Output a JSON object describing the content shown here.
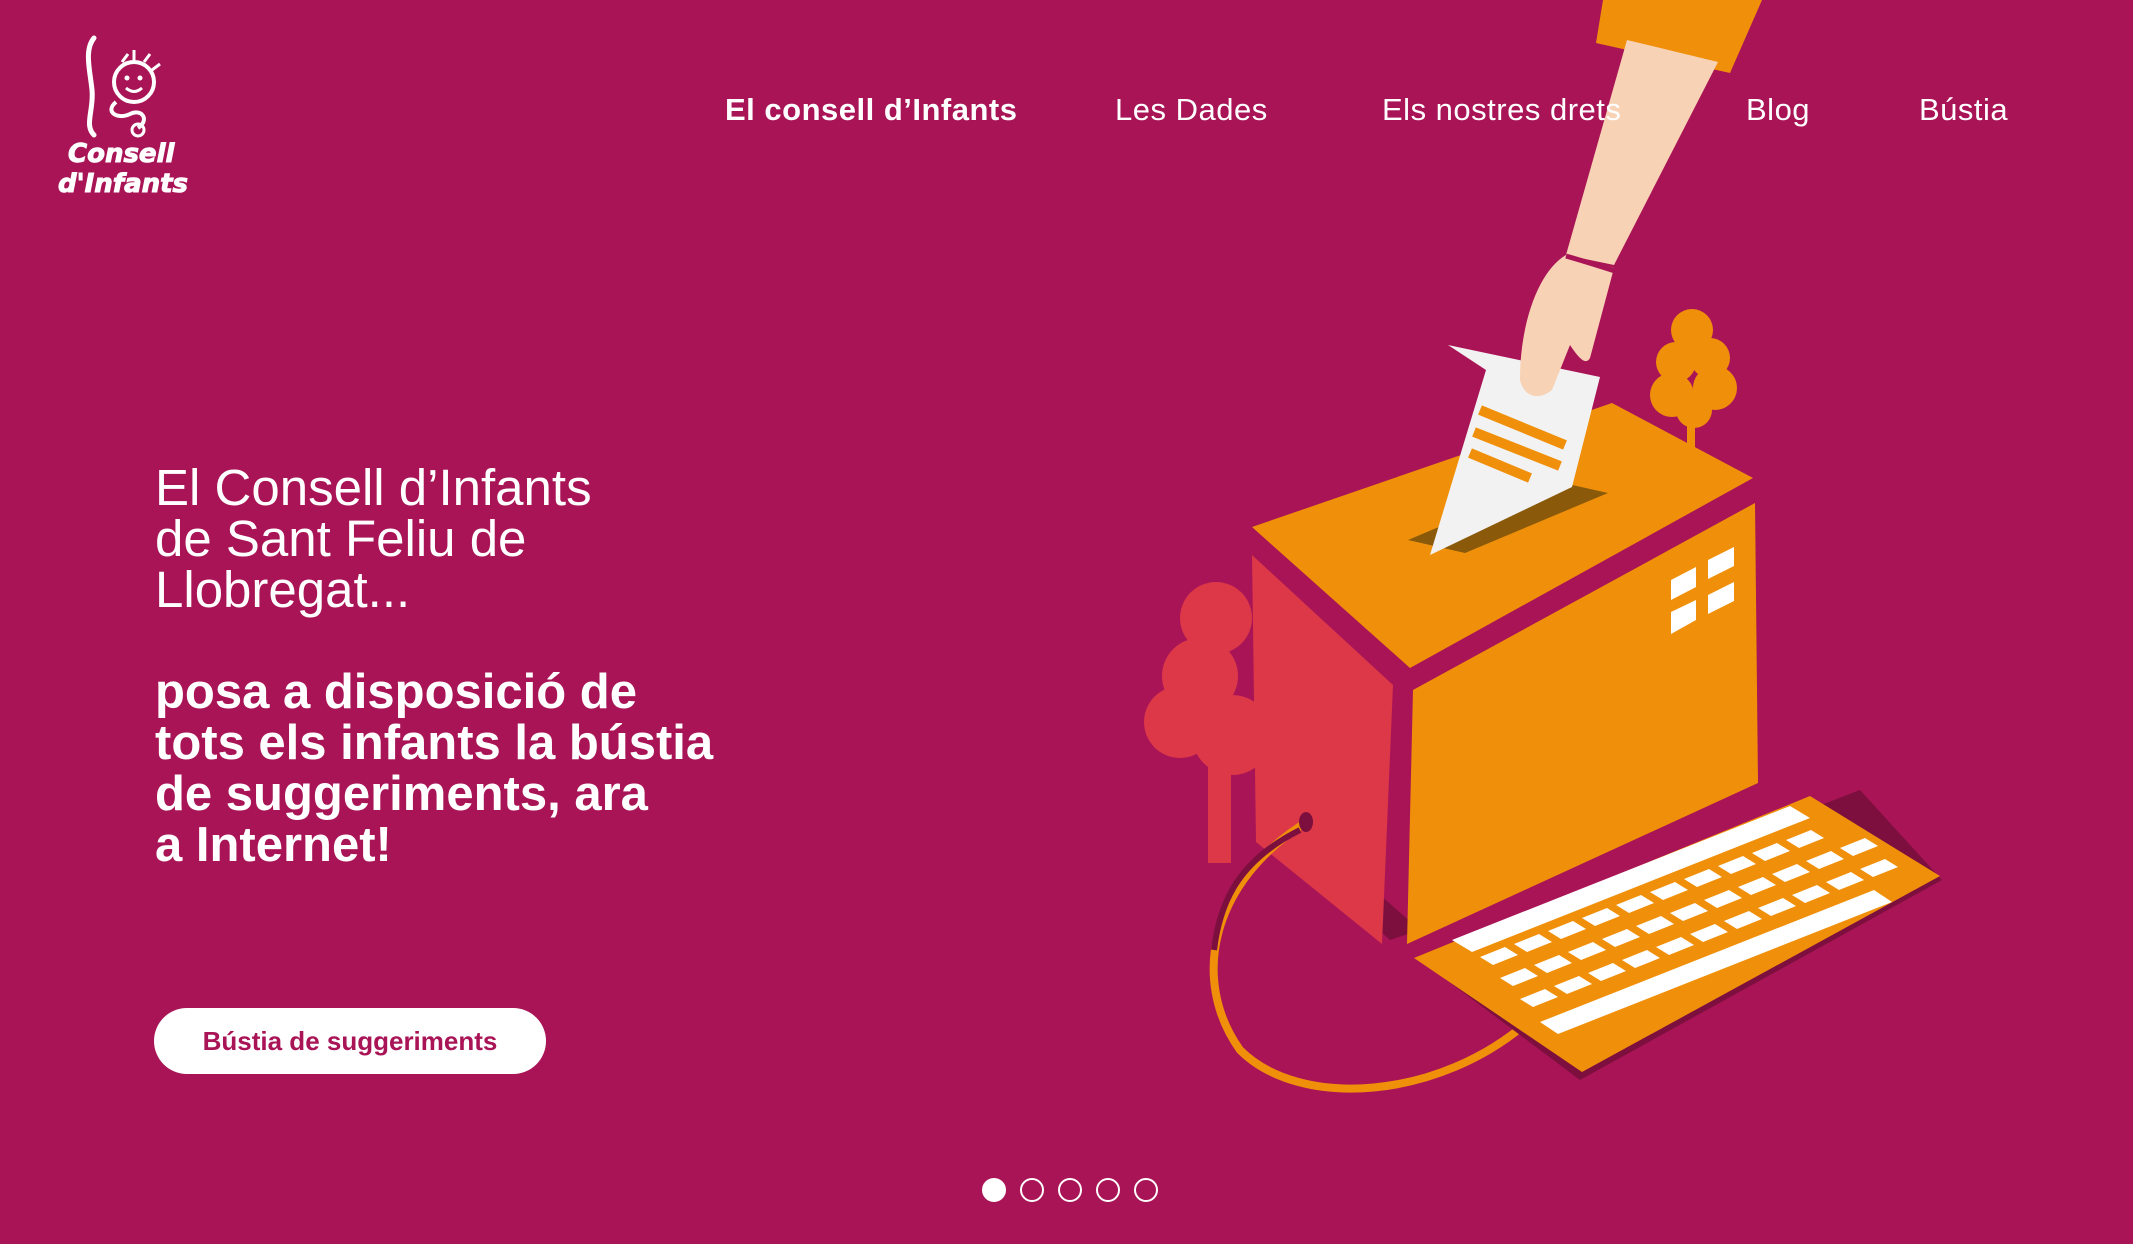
{
  "brand": {
    "logo_line1": "Consell",
    "logo_line2": "d'Infants"
  },
  "nav": {
    "items": [
      {
        "label": "El consell d’Infants",
        "active": true
      },
      {
        "label": "Les Dades",
        "active": false
      },
      {
        "label": "Els nostres drets",
        "active": false
      },
      {
        "label": "Blog",
        "active": false
      },
      {
        "label": "Bústia",
        "active": false
      }
    ]
  },
  "hero": {
    "intro_lines": [
      "El Consell d’Infants",
      "de Sant Feliu de",
      "Llobregat..."
    ],
    "main_lines": [
      "posa a disposició de",
      "tots els infants la bústia",
      "de suggeriments, ara",
      "a Internet!"
    ],
    "cta_label": "Bústia de suggeriments"
  },
  "carousel": {
    "total_slides": 5,
    "active_index": 0
  },
  "colors": {
    "background": "#a91456",
    "accent_orange": "#f0900a",
    "accent_red": "#dc3848",
    "text": "#ffffff"
  },
  "icons": {
    "logo": "child-face-logo",
    "illustration": "ballot-box-computer-illustration"
  }
}
